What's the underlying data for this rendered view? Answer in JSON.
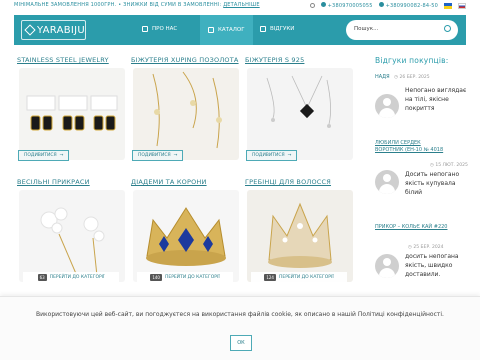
{
  "topbar": {
    "promo_text": "МІНІМАЛЬНЕ ЗАМОВЛЕННЯ 1000ГРН. • ЗНИЖКИ ВІД СУМИ В ЗАМОВЛЕННІ:",
    "promo_link": "ДЕТАЛЬНІШЕ",
    "phone1": "+380970005055",
    "phone2": "+380990082-84-50"
  },
  "header": {
    "logo_text": "YARABIJU",
    "nav": [
      {
        "label": "ПРО НАС"
      },
      {
        "label": "КАТАЛОГ"
      },
      {
        "label": "ВІДГУКИ"
      }
    ],
    "search_placeholder": "Пошук..."
  },
  "categories": [
    {
      "title": "STAINLESS STEEL JEWELRY",
      "button": "ПОДИВИТИСЯ"
    },
    {
      "title": "БІЖУТЕРІЯ XUPING ПОЗОЛОТА",
      "button": "ПОДИВИТИСЯ"
    },
    {
      "title": "БІЖУТЕРІЯ S 925",
      "button": "ПОДИВИТИСЯ"
    },
    {
      "title": "ВЕСІЛЬНІ ПРИКРАСИ",
      "button": "ПЕРЕЙТИ ДО КАТЕГОРІЇ",
      "count": "63"
    },
    {
      "title": "ДІАДЕМИ ТА КОРОНИ",
      "button": "ПЕРЕЙТИ ДО КАТЕГОРІЇ",
      "count": "140"
    },
    {
      "title": "ГРЕБІНЦІ ДЛЯ ВОЛОССЯ",
      "button": "ПЕРЕЙТИ ДО КАТЕГОРІЇ",
      "count": "124"
    }
  ],
  "reviews": {
    "title": "Відгуки покупців:",
    "items": [
      {
        "author": "НАДЯ",
        "date": "26 БЕР. 2025",
        "product": "",
        "text": "Непогано виглядає на тілі, якісне покриття"
      },
      {
        "author": "",
        "date": "15 ЛЮТ. 2025",
        "product": "ЛЮБИЛИ СЕРДЕК ВОРОТНИК (ЕН-10 № 4018",
        "text": "Досить непогано якість купувала білий"
      },
      {
        "author": "ПРИКОР – КОЛЬЄ КАЙ #220",
        "date": "25 БЕР. 2024",
        "product": "",
        "text": "досить непогана якість, швидко доставили."
      }
    ]
  },
  "cookie": {
    "text": "Використовуючи цей веб-сайт, ви погоджуєтеся на використання файлів cookie, як описано в нашій Політиці конфіденційності.",
    "ok_label": "ОК"
  }
}
